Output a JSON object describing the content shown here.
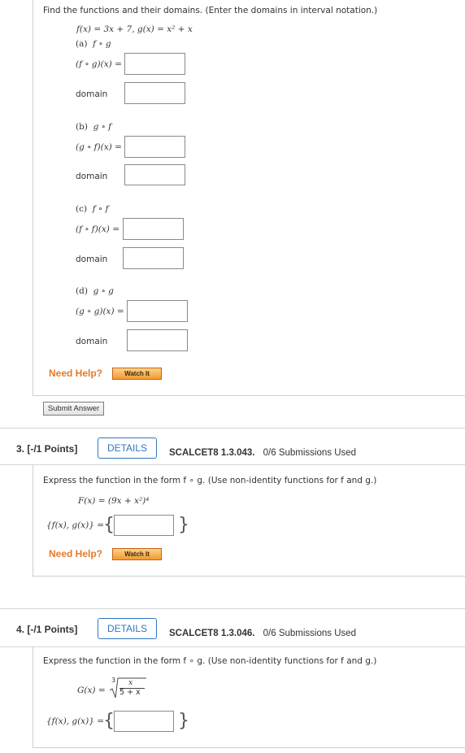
{
  "q2": {
    "instruction": "Find the functions and their domains. (Enter the domains in interval notation.)",
    "given": "f(x) = 3x + 7,   g(x) = x² + x",
    "parts": [
      {
        "label": "(a)",
        "composition": "f ∘ g",
        "expr": "(f ∘ g)(x) =",
        "answer": "",
        "domain_label": "domain",
        "domain_answer": ""
      },
      {
        "label": "(b)",
        "composition": "g ∘ f",
        "expr": "(g ∘ f)(x) =",
        "answer": "",
        "domain_label": "domain",
        "domain_answer": ""
      },
      {
        "label": "(c)",
        "composition": "f ∘ f",
        "expr": "(f ∘ f)(x) =",
        "answer": "",
        "domain_label": "domain",
        "domain_answer": ""
      },
      {
        "label": "(d)",
        "composition": "g ∘ g",
        "expr": "(g ∘ g)(x) =",
        "answer": "",
        "domain_label": "domain",
        "domain_answer": ""
      }
    ],
    "need_help": "Need Help?",
    "watch_it": "Watch It",
    "submit": "Submit Answer"
  },
  "q3": {
    "number": "3.  [-/1 Points]",
    "details": "DETAILS",
    "code": "SCALCET8 1.3.043.",
    "submissions": "0/6 Submissions Used",
    "instruction": "Express the function in the form f ∘ g. (Use non-identity functions for f and g.)",
    "function": "F(x) = (9x + x²)⁴",
    "answer_label": "{f(x), g(x)} =",
    "answer": "",
    "need_help": "Need Help?",
    "watch_it": "Watch It"
  },
  "q4": {
    "number": "4.  [-/1 Points]",
    "details": "DETAILS",
    "code": "SCALCET8 1.3.046.",
    "submissions": "0/6 Submissions Used",
    "instruction": "Express the function in the form f ∘ g. (Use non-identity functions for f and g.)",
    "function_lhs": "G(x) =",
    "root_index": "3",
    "numerator": "x",
    "denominator": "5 + x",
    "answer_label": "{f(x), g(x)} =",
    "answer": ""
  }
}
